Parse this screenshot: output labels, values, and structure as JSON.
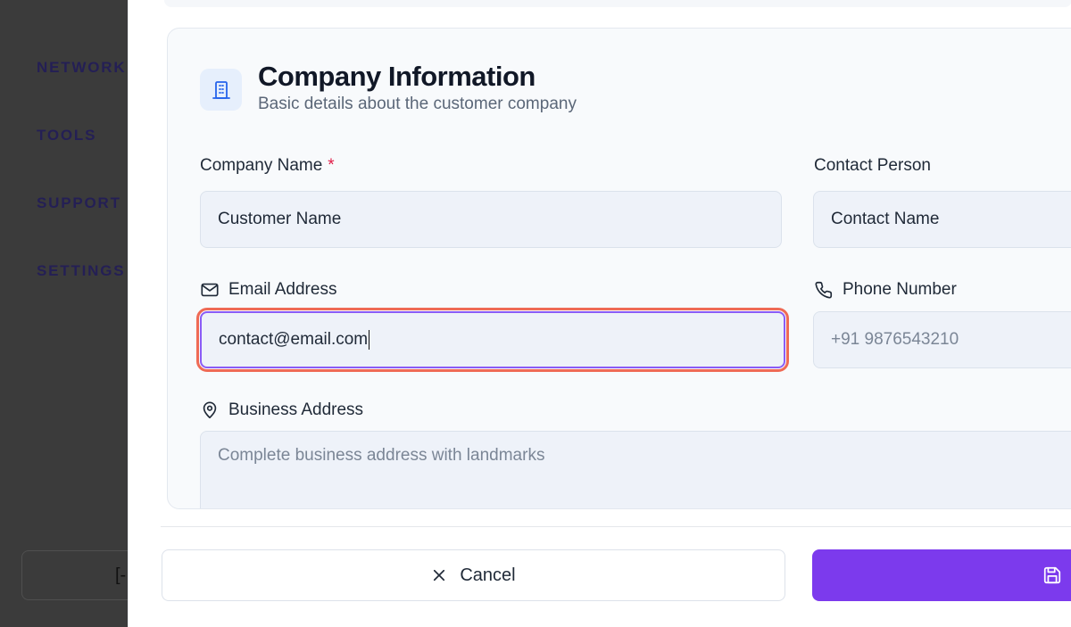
{
  "sidebar": {
    "items": [
      {
        "label": "NETWORK"
      },
      {
        "label": "TOOLS"
      },
      {
        "label": "SUPPORT &"
      },
      {
        "label": "SETTINGS"
      }
    ],
    "logout_glyph": "[-"
  },
  "section": {
    "title": "Company Information",
    "subtitle": "Basic details about the customer company",
    "icon": "building-icon"
  },
  "fields": {
    "company_name": {
      "label": "Company Name",
      "required_mark": "*",
      "value": "Customer Name"
    },
    "contact_person": {
      "label": "Contact Person",
      "value": "Contact Name"
    },
    "email": {
      "label": "Email Address",
      "value": "contact@email.com",
      "icon": "mail-icon"
    },
    "phone": {
      "label": "Phone Number",
      "placeholder": "+91 9876543210",
      "icon": "phone-icon"
    },
    "address": {
      "label": "Business Address",
      "placeholder": "Complete business address with landmarks",
      "icon": "map-pin-icon"
    }
  },
  "actions": {
    "cancel_label": "Cancel",
    "cancel_icon": "close-icon",
    "save_icon": "save-icon"
  },
  "colors": {
    "accent": "#7c3aed",
    "focus_ring": "#ef6a55",
    "required": "#e11d48",
    "icon_blue": "#2563eb"
  }
}
